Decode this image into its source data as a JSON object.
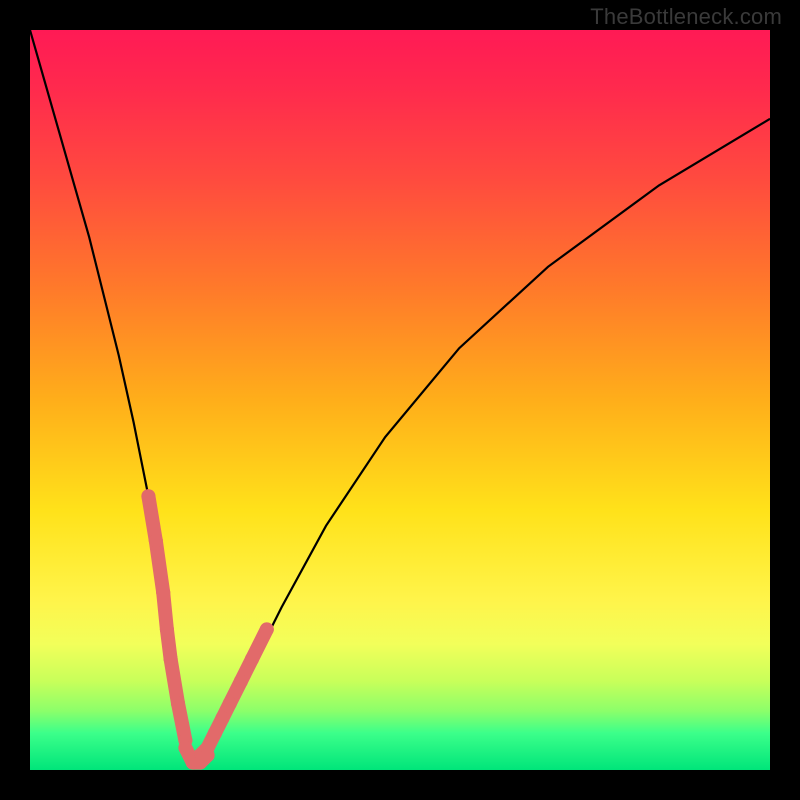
{
  "watermark": "TheBottleneck.com",
  "chart_data": {
    "type": "line",
    "title": "",
    "xlabel": "",
    "ylabel": "",
    "xlim": [
      0,
      100
    ],
    "ylim": [
      0,
      100
    ],
    "grid": false,
    "legend": false,
    "series": [
      {
        "name": "bottleneck-curve",
        "x": [
          0,
          2,
          4,
          6,
          8,
          10,
          12,
          14,
          16,
          18,
          19,
          20,
          21,
          22,
          23,
          24,
          25,
          27,
          30,
          34,
          40,
          48,
          58,
          70,
          85,
          100
        ],
        "y": [
          100,
          93,
          86,
          79,
          72,
          64,
          56,
          47,
          37,
          22,
          15,
          9,
          4,
          1,
          1,
          2,
          4,
          8,
          14,
          22,
          33,
          45,
          57,
          68,
          79,
          88
        ]
      }
    ],
    "markers": [
      {
        "name": "left-highlight",
        "points": [
          [
            16,
            37
          ],
          [
            17,
            31
          ],
          [
            18,
            24
          ],
          [
            18.5,
            19
          ],
          [
            19,
            15
          ],
          [
            20,
            9
          ],
          [
            21,
            4
          ]
        ]
      },
      {
        "name": "right-highlight",
        "points": [
          [
            23,
            2
          ],
          [
            24,
            3
          ],
          [
            25,
            5
          ],
          [
            26,
            7
          ],
          [
            27,
            9
          ],
          [
            28.5,
            12
          ],
          [
            30,
            15
          ],
          [
            32,
            19
          ]
        ]
      },
      {
        "name": "bottom-highlight",
        "points": [
          [
            21,
            3
          ],
          [
            22,
            1
          ],
          [
            23,
            1
          ],
          [
            24,
            2
          ]
        ]
      }
    ],
    "colors": {
      "curve": "#000000",
      "marker": "#e26a6a",
      "gradient_top": "#ff1a55",
      "gradient_bottom": "#00e57a"
    }
  }
}
